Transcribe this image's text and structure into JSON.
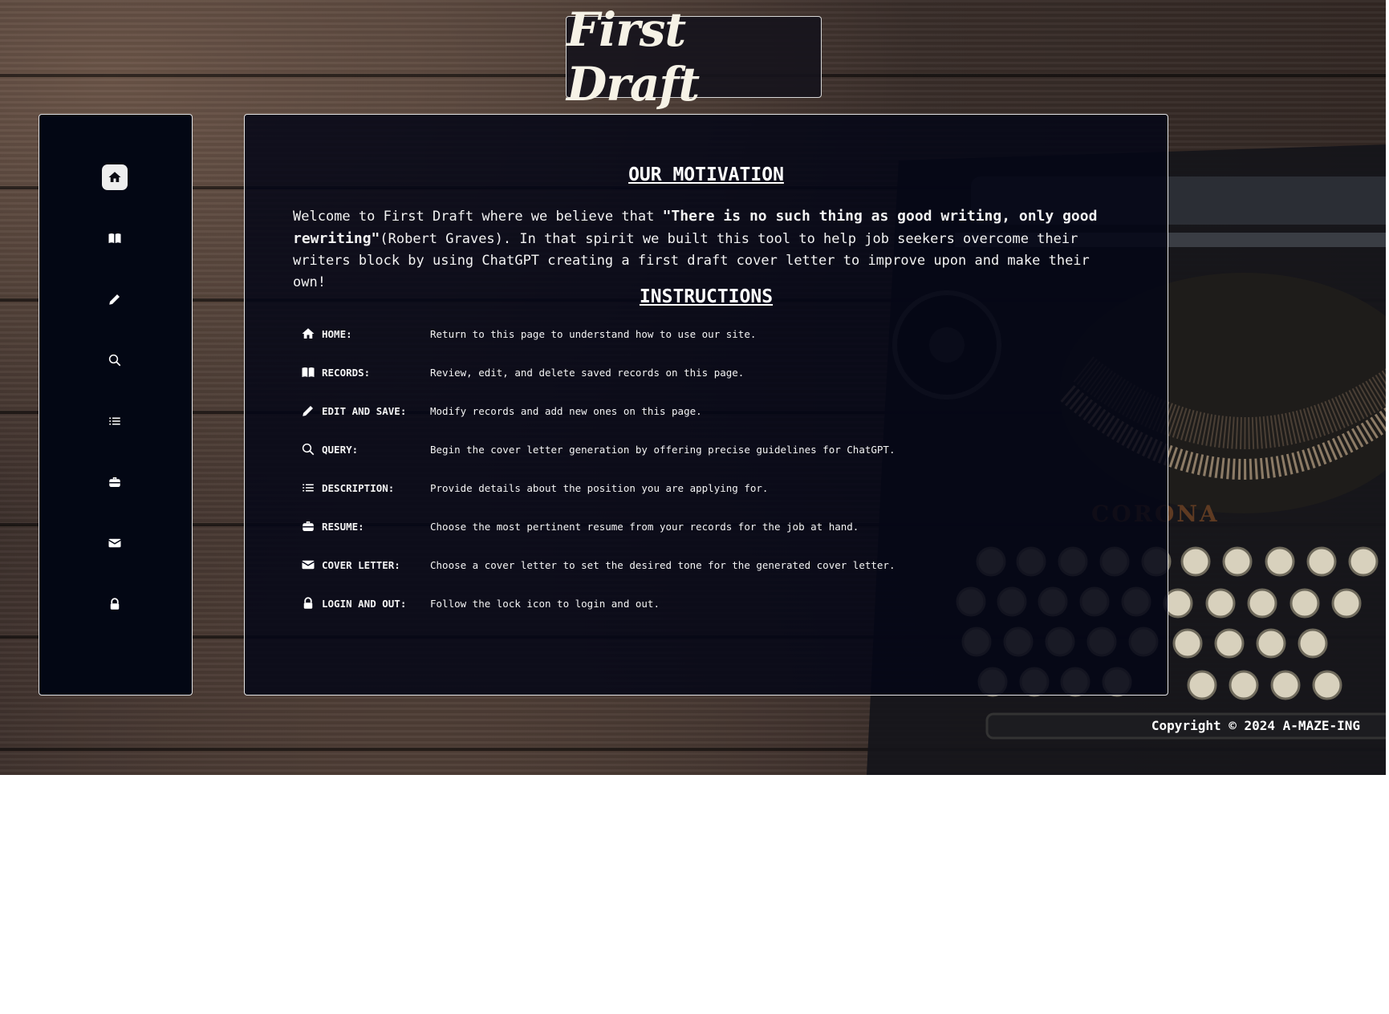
{
  "header": {
    "title": "First Draft"
  },
  "sidebar": {
    "items": [
      {
        "icon": "home-icon",
        "label": "Home",
        "active": true
      },
      {
        "icon": "book-icon",
        "label": "Records"
      },
      {
        "icon": "pencil-icon",
        "label": "Edit and Save"
      },
      {
        "icon": "search-icon",
        "label": "Query"
      },
      {
        "icon": "list-icon",
        "label": "Description"
      },
      {
        "icon": "briefcase-icon",
        "label": "Resume"
      },
      {
        "icon": "envelope-icon",
        "label": "Cover Letter"
      },
      {
        "icon": "lock-icon",
        "label": "Login and Out"
      }
    ]
  },
  "main": {
    "motivation": {
      "title": "OUR MOTIVATION",
      "intro": "Welcome to First Draft where we believe that ",
      "quote": "\"There is no such thing as good writing, only good rewriting\"",
      "body": "(Robert Graves). In that spirit we built this tool to help job seekers overcome their writers block by using ChatGPT creating a first draft cover letter to improve upon and make their own!"
    },
    "instructions": {
      "title": "INSTRUCTIONS",
      "items": [
        {
          "icon": "home-icon",
          "label": "HOME:",
          "desc": "Return to this page to understand how to use our site."
        },
        {
          "icon": "book-icon",
          "label": "RECORDS:",
          "desc": "Review, edit, and delete saved records on this page."
        },
        {
          "icon": "pencil-icon",
          "label": "EDIT AND SAVE:",
          "desc": "Modify records and add new ones on this page."
        },
        {
          "icon": "search-icon",
          "label": "QUERY:",
          "desc": "Begin the cover letter generation by offering precise guidelines for ChatGPT."
        },
        {
          "icon": "list-icon",
          "label": "DESCRIPTION:",
          "desc": "Provide details about the position you are applying for."
        },
        {
          "icon": "briefcase-icon",
          "label": "RESUME:",
          "desc": "Choose the most pertinent resume from your records for the job at hand."
        },
        {
          "icon": "envelope-icon",
          "label": "COVER LETTER:",
          "desc": "Choose a cover letter to set the desired tone for the generated cover letter."
        },
        {
          "icon": "lock-icon",
          "label": "LOGIN AND OUT:",
          "desc": "Follow the lock icon to login and out."
        }
      ]
    }
  },
  "footer": {
    "copyright": "Copyright © 2024 A-MAZE-ING"
  },
  "colors": {
    "panel": "#030714",
    "text": "#ffffff",
    "wood": "#3b2f2b",
    "title": "#f6f2e6"
  },
  "background": {
    "watermark": "CORONA"
  }
}
